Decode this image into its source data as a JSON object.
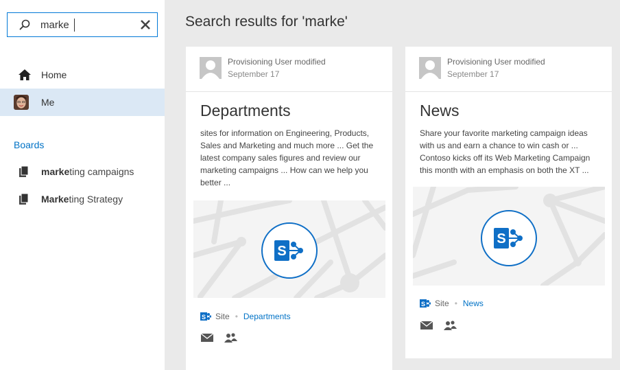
{
  "search": {
    "value": "marke",
    "placeholder": ""
  },
  "nav": {
    "home_label": "Home",
    "me_label": "Me"
  },
  "boards": {
    "heading": "Boards",
    "items": [
      {
        "bold": "marke",
        "rest": "ting campaigns"
      },
      {
        "bold": "Marke",
        "rest": "ting Strategy"
      }
    ]
  },
  "results": {
    "title": "Search results for 'marke'",
    "cards": [
      {
        "modified_by": "Provisioning User modified",
        "date": "September 17",
        "title": "Departments",
        "description": "sites for information on Engineering, Products, Sales and Marketing and much more ... Get the latest company sales figures and review our marketing campaigns ... How can we help you better ...",
        "type": "Site",
        "link": "Departments"
      },
      {
        "modified_by": "Provisioning User modified",
        "date": "September 17",
        "title": "News",
        "description": "Share your favorite marketing campaign ideas with us and earn a chance to win cash or ... Contoso kicks off its Web Marketing Campaign this month with an emphasis on both the XT ...",
        "type": "Site",
        "link": "News"
      }
    ]
  },
  "colors": {
    "accent": "#0072c6",
    "sharepoint_blue": "#0f6fc6",
    "selected_nav": "#dbe8f5",
    "page_bg": "#eaeaea"
  },
  "icons": {
    "search": "magnifier-icon",
    "clear": "close-icon",
    "home": "home-icon",
    "board": "board-icon",
    "site": "sharepoint-icon",
    "email": "email-icon",
    "people": "people-icon"
  }
}
